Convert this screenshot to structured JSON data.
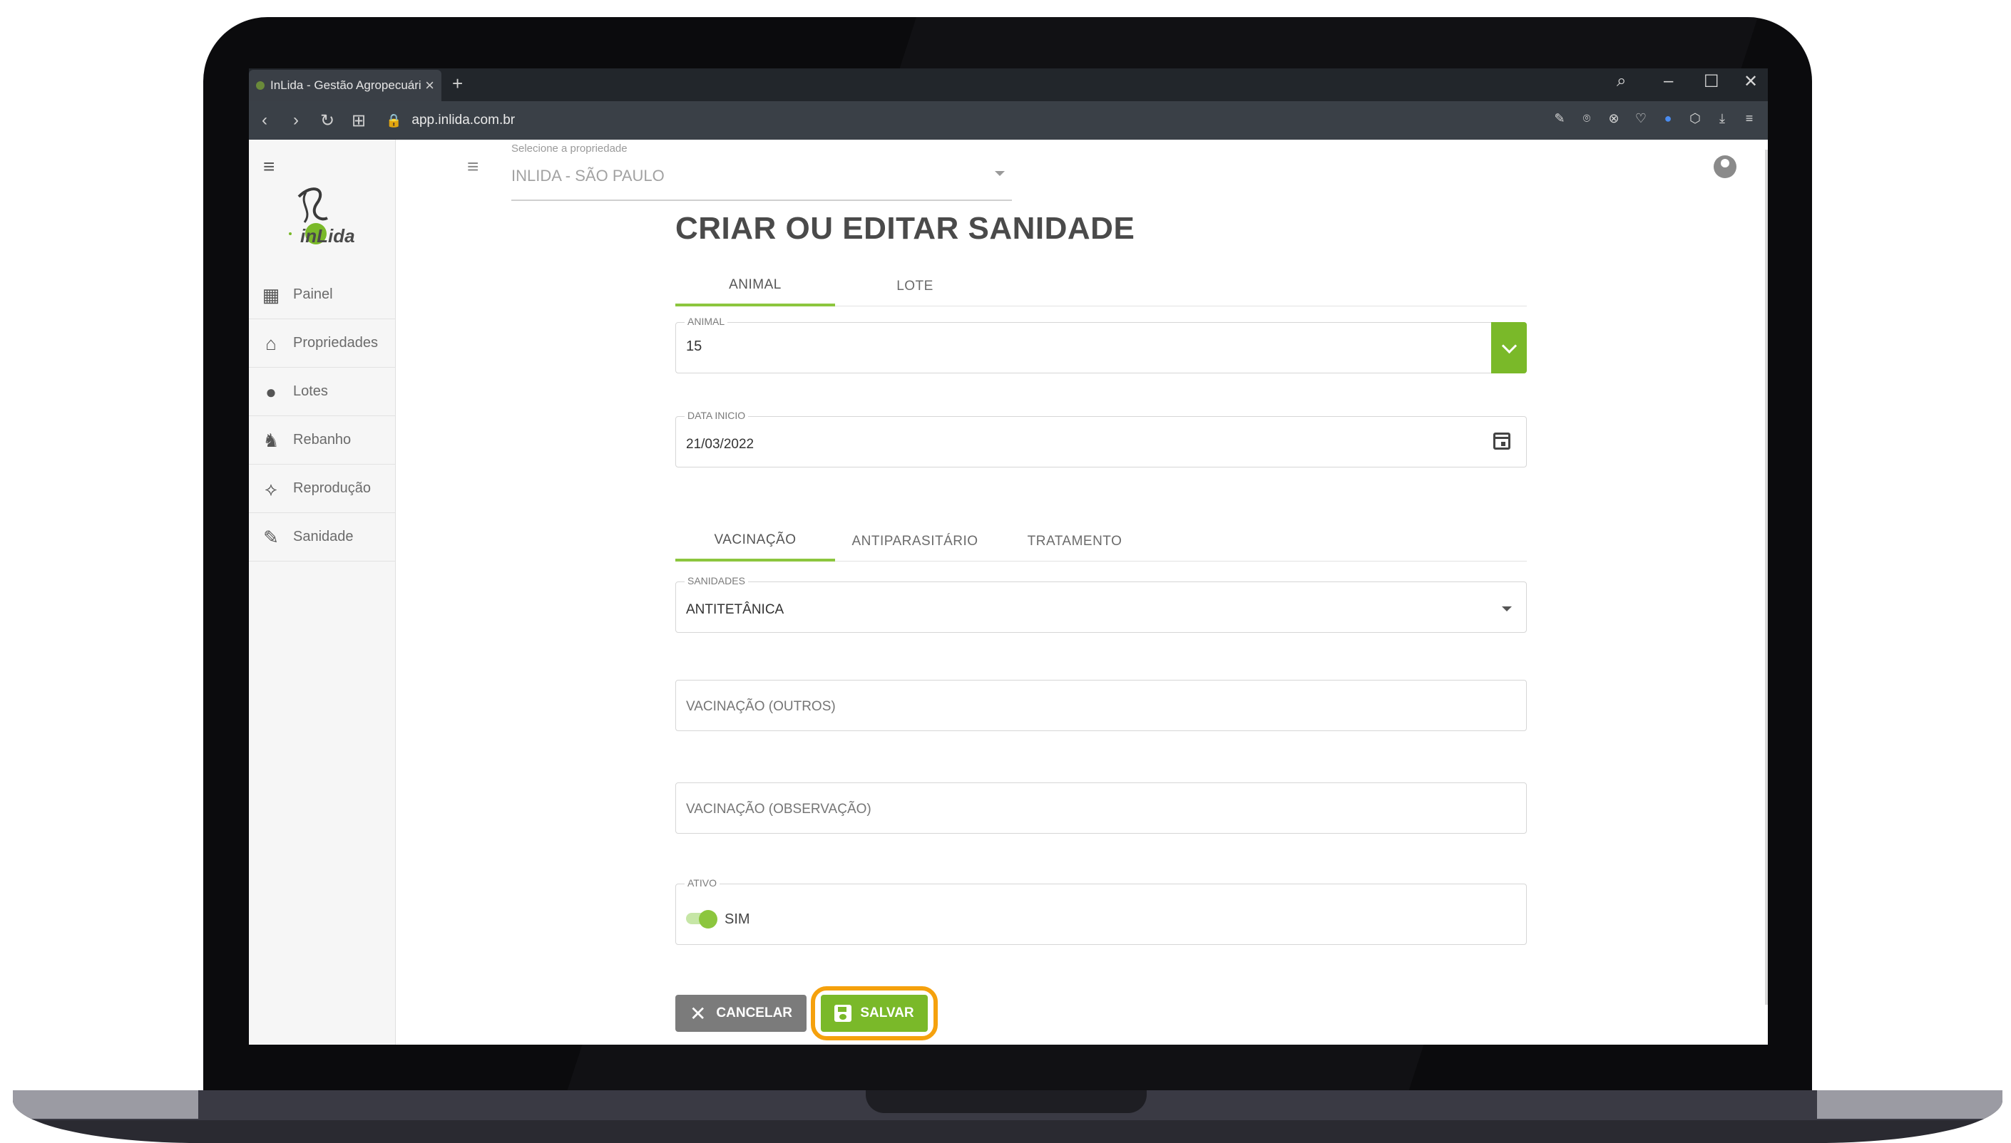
{
  "browser": {
    "tab_title": "InLida - Gestão Agropecuária",
    "tab_close": "×",
    "new_tab": "+",
    "url": "app.inlida.com.br",
    "window_controls": [
      "⌕",
      "–",
      "☐",
      "✕"
    ],
    "nav": [
      "‹",
      "›",
      "↻",
      "⊞"
    ],
    "extensions": [
      "✎",
      "⌾",
      "⊗",
      "♡",
      "●",
      "⬡",
      "⤓",
      "≡"
    ]
  },
  "sidebar": {
    "logo_text": "inLida",
    "items": [
      {
        "label": "Painel",
        "icon": "dashboard-icon",
        "glyph": "▦"
      },
      {
        "label": "Propriedades",
        "icon": "barn-icon",
        "glyph": "⌂"
      },
      {
        "label": "Lotes",
        "icon": "group-icon",
        "glyph": "●"
      },
      {
        "label": "Rebanho",
        "icon": "cow-icon",
        "glyph": "♞"
      },
      {
        "label": "Reprodução",
        "icon": "dna-icon",
        "glyph": "⟡"
      },
      {
        "label": "Sanidade",
        "icon": "syringe-icon",
        "glyph": "✎"
      }
    ]
  },
  "header": {
    "property_label": "Selecione a propriedade",
    "property_value": "INLIDA - SÃO PAULO"
  },
  "main": {
    "title": "CRIAR OU EDITAR SANIDADE",
    "tabs": [
      "ANIMAL",
      "LOTE"
    ],
    "animal": {
      "label": "ANIMAL",
      "value": "15"
    },
    "data_inicio": {
      "label": "DATA INICIO",
      "value": "21/03/2022"
    },
    "subtabs": [
      "VACINAÇÃO",
      "ANTIPARASITÁRIO",
      "TRATAMENTO"
    ],
    "sanidades": {
      "label": "SANIDADES",
      "value": "ANTITETÂNICA"
    },
    "vacinacao_outros": {
      "placeholder": "VACINAÇÃO (OUTROS)"
    },
    "vacinacao_obs": {
      "placeholder": "VACINAÇÃO (OBSERVAÇÃO)"
    },
    "ativo": {
      "label": "ATIVO",
      "value": "SIM"
    },
    "buttons": {
      "cancel": "CANCELAR",
      "save": "SALVAR"
    }
  },
  "colors": {
    "accent": "#7ab929",
    "highlight": "#f5a10d",
    "cancel": "#7b7b7b"
  }
}
